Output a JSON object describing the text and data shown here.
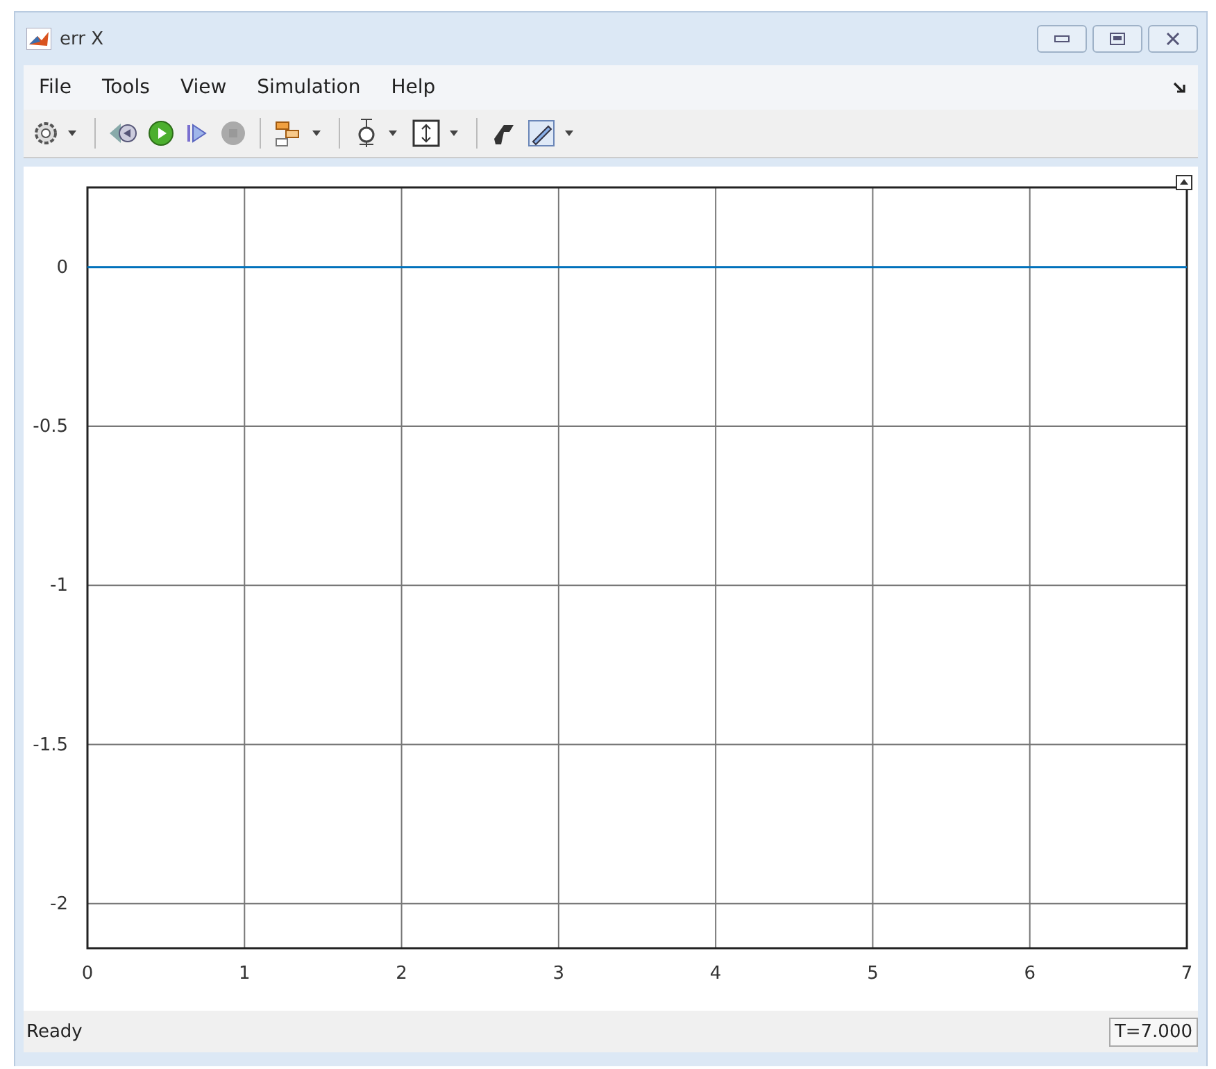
{
  "window": {
    "title": "err X"
  },
  "menu": [
    {
      "label": "File"
    },
    {
      "label": "Tools"
    },
    {
      "label": "View"
    },
    {
      "label": "Simulation"
    },
    {
      "label": "Help"
    }
  ],
  "scope": {
    "chart_data": {
      "type": "line",
      "x": [
        0,
        7
      ],
      "series": [
        {
          "color": "#0072bd",
          "values": [
            0,
            0
          ]
        }
      ],
      "grid": true,
      "xlim": [
        0,
        7
      ],
      "ylim": [
        -2.14,
        0.25
      ],
      "xticks": [
        0,
        1,
        2,
        3,
        4,
        5,
        6,
        7
      ],
      "yticks": [
        -2,
        -1.5,
        -1,
        -0.5,
        0
      ]
    }
  },
  "status_bar": {
    "text": "Ready",
    "time": "T=7.000"
  }
}
